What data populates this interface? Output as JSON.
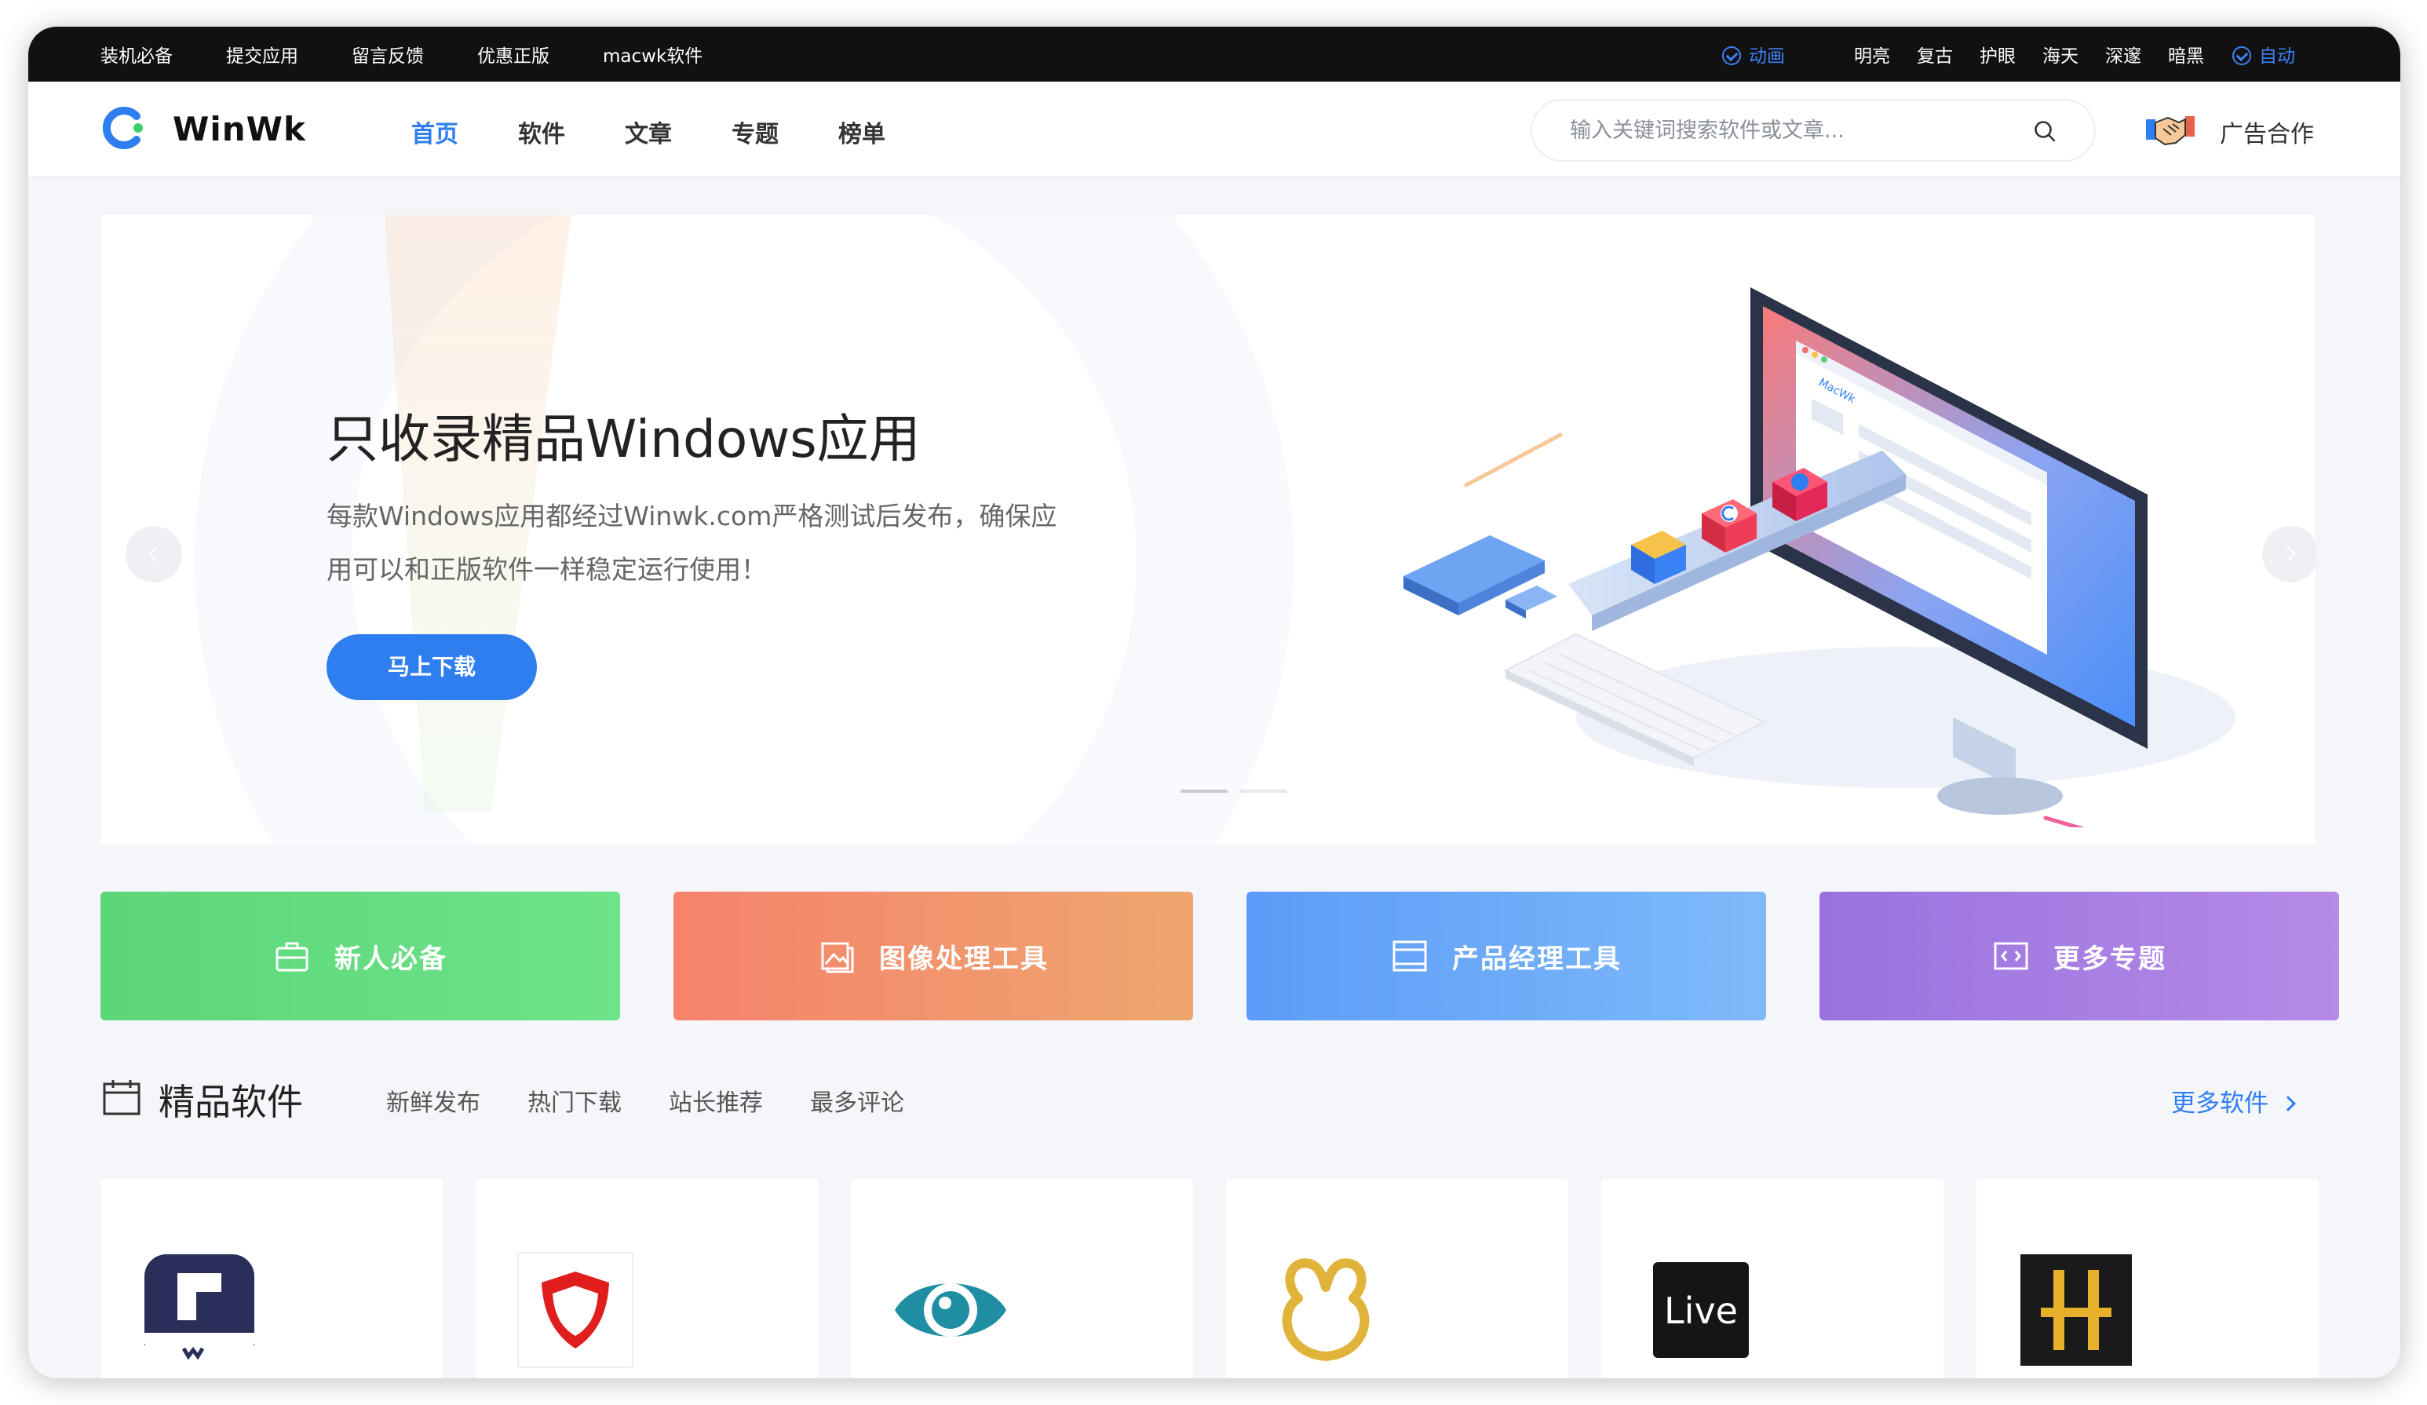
{
  "topbar": {
    "links": [
      "装机必备",
      "提交应用",
      "留言反馈",
      "优惠正版",
      "macwk软件"
    ],
    "animation_label": "动画",
    "themes": [
      "明亮",
      "复古",
      "护眼",
      "海天",
      "深邃",
      "暗黑"
    ],
    "auto_label": "自动"
  },
  "header": {
    "logo_text": "WinWk",
    "nav": [
      "首页",
      "软件",
      "文章",
      "专题",
      "榜单"
    ],
    "search_placeholder": "输入关键词搜索软件或文章...",
    "ad_label": "广告合作",
    "accent_color": "#2f7ef0"
  },
  "banner": {
    "title": "只收录精品Windows应用",
    "subtitle": "每款Windows应用都经过Winwk.com严格测试后发布，确保应用可以和正版软件一样稳定运行使用！",
    "button_label": "马上下载",
    "screen_brand": "MacWk"
  },
  "categories": [
    {
      "label": "新人必备",
      "icon": "briefcase-icon",
      "color_from": "#5cd679",
      "color_to": "#6ee38a"
    },
    {
      "label": "图像处理工具",
      "icon": "image-icon",
      "color_from": "#f6826c",
      "color_to": "#eda66e"
    },
    {
      "label": "产品经理工具",
      "icon": "window-icon",
      "color_from": "#5b9cf8",
      "color_to": "#7fbaf9"
    },
    {
      "label": "更多专题",
      "icon": "code-icon",
      "color_from": "#9a72df",
      "color_to": "#b48be6"
    }
  ],
  "section": {
    "title": "精品软件",
    "tabs": [
      "新鲜发布",
      "热门下载",
      "站长推荐",
      "最多评论"
    ],
    "more_label": "更多软件"
  },
  "apps": [
    {
      "icon": "wondershare-pdfelement-icon"
    },
    {
      "icon": "red-shield-antivirus-icon"
    },
    {
      "icon": "teal-eye-icon"
    },
    {
      "icon": "navicat-icon"
    },
    {
      "icon": "ableton-live-icon",
      "label": "Live"
    },
    {
      "icon": "h-logo-icon"
    }
  ]
}
